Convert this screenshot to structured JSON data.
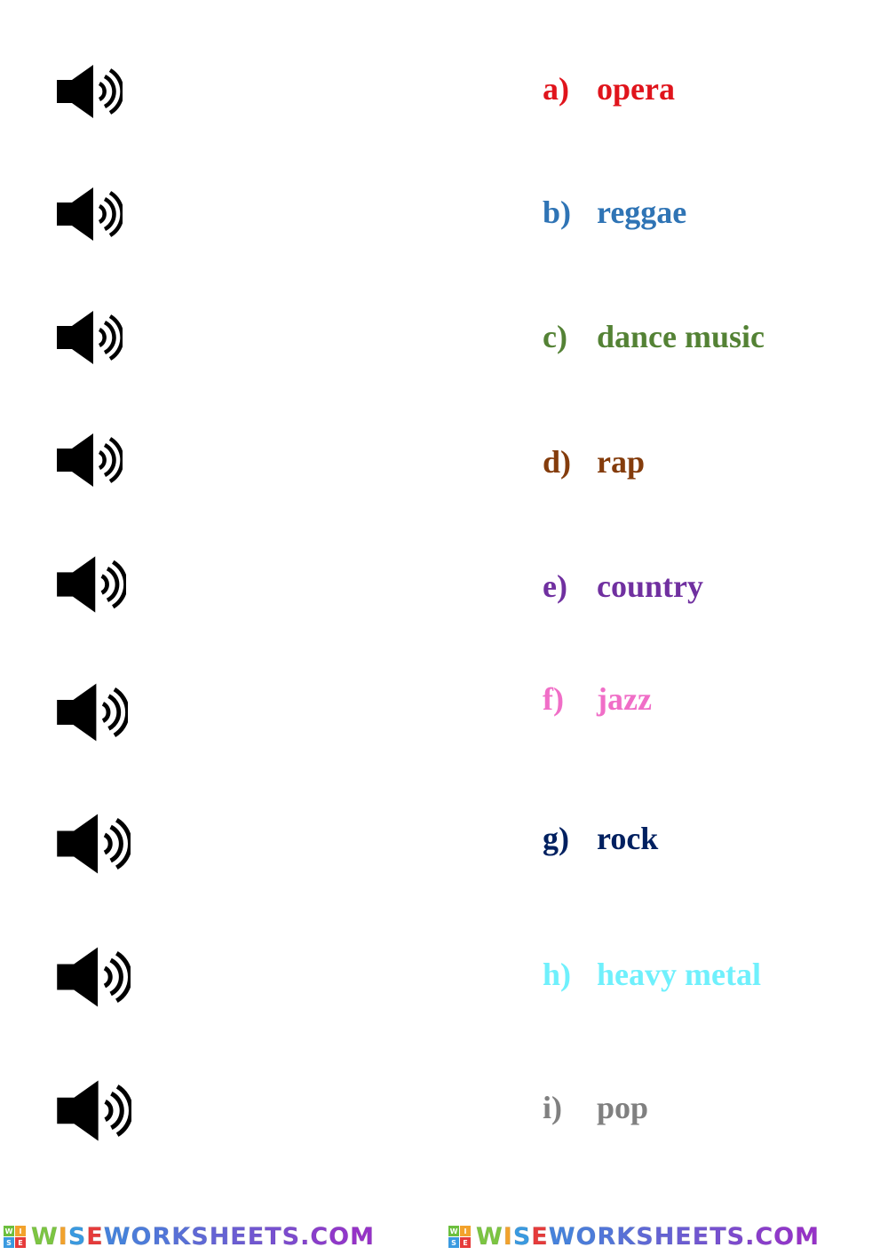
{
  "items": [
    {
      "letter": "a)",
      "word": "opera",
      "color": "#e0141c"
    },
    {
      "letter": "b)",
      "word": "reggae",
      "color": "#2f74b5"
    },
    {
      "letter": "c)",
      "word": "dance music",
      "color": "#548235"
    },
    {
      "letter": "d)",
      "word": "rap",
      "color": "#843c0c"
    },
    {
      "letter": "e)",
      "word": "country",
      "color": "#7030a0"
    },
    {
      "letter": "f)",
      "word": "jazz",
      "color": "#f06ec7"
    },
    {
      "letter": "g)",
      "word": "rock",
      "color": "#002060"
    },
    {
      "letter": "h)",
      "word": "heavy metal",
      "color": "#6ff0fc"
    },
    {
      "letter": "i)",
      "word": "pop",
      "color": "#808080"
    }
  ],
  "audio_buttons": [
    {
      "icon": "speaker-icon"
    },
    {
      "icon": "speaker-icon"
    },
    {
      "icon": "speaker-icon"
    },
    {
      "icon": "speaker-icon"
    },
    {
      "icon": "speaker-icon"
    },
    {
      "icon": "speaker-icon"
    },
    {
      "icon": "speaker-icon"
    },
    {
      "icon": "speaker-icon"
    },
    {
      "icon": "speaker-icon"
    }
  ],
  "footer": {
    "logo_grid": [
      "W",
      "I",
      "S",
      "E"
    ],
    "logo_text": "WISEWORKSHEETS.COM",
    "logo_text_2": "WISEWORKSHEETS.COM"
  }
}
